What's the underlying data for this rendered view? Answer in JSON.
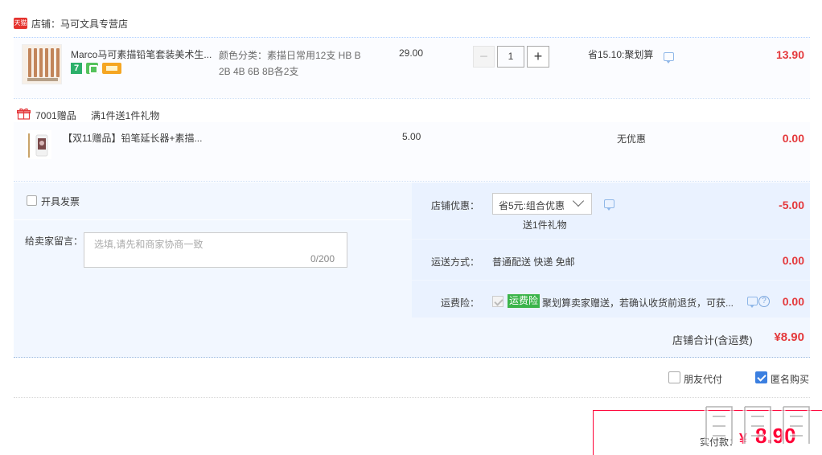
{
  "shop": {
    "badge": "天猫",
    "label": "店铺：马可文具专营店"
  },
  "item1": {
    "title": "Marco马可素描铅笔套装美术生...",
    "badges": [
      "7"
    ],
    "sku": "颜色分类：素描日常用12支 HB B 2B 4B 6B 8B各2支",
    "price": "29.00",
    "quantity": "1",
    "minus": "−",
    "plus": "+",
    "discount": "省15.10:聚划算",
    "subtotal": "13.90"
  },
  "gift": {
    "label": "7001赠品",
    "rule": "满1件送1件礼物",
    "title": "【双11赠品】铅笔延长器+素描...",
    "price": "5.00",
    "discount": "无优惠",
    "subtotal": "0.00"
  },
  "invoice": {
    "label": "开具发票"
  },
  "message": {
    "label": "给卖家留言：",
    "placeholder": "选填,请先和商家协商一致",
    "count": "0/200"
  },
  "shop_discount": {
    "label": "店铺优惠：",
    "value": "省5元:组合优惠",
    "sub": "送1件礼物",
    "amount": "-5.00"
  },
  "shipping": {
    "label": "运送方式：",
    "value": "普通配送 快递 免邮",
    "amount": "0.00"
  },
  "insurance": {
    "label": "运费险：",
    "tag": "运费险",
    "desc": "聚划算卖家赠送，若确认收货前退货，可获...",
    "amount": "0.00"
  },
  "shop_total": {
    "label": "店铺合计(含运费)",
    "amount": "¥8.90"
  },
  "options": {
    "friend_pay": "朋友代付",
    "anonymous": "匿名购买"
  },
  "pay": {
    "label": "实付款：",
    "currency": "¥",
    "amount": "8.90"
  },
  "colors": {
    "accent_red": "#e4393c",
    "pay_red": "#ff0036",
    "panel_blue": "#f2f7ff",
    "tag_green": "#3bb44a"
  }
}
